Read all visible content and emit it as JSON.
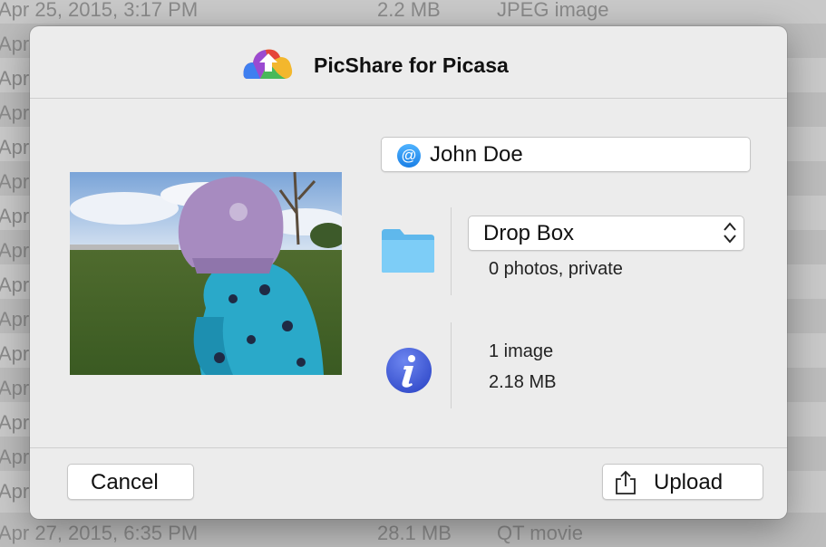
{
  "background_list": {
    "rows": [
      {
        "date": "Apr 25, 2015, 3:17 PM",
        "size": "2.2 MB",
        "kind": "JPEG image"
      },
      {
        "date": "Apr",
        "size": "",
        "kind": ""
      },
      {
        "date": "Apr",
        "size": "",
        "kind": ""
      },
      {
        "date": "Apr",
        "size": "",
        "kind": ""
      },
      {
        "date": "Apr",
        "size": "",
        "kind": ""
      },
      {
        "date": "Apr",
        "size": "",
        "kind": ""
      },
      {
        "date": "Apr",
        "size": "",
        "kind": ""
      },
      {
        "date": "Apr",
        "size": "",
        "kind": ""
      },
      {
        "date": "Apr",
        "size": "",
        "kind": ""
      },
      {
        "date": "Apr",
        "size": "",
        "kind": ""
      },
      {
        "date": "Apr",
        "size": "",
        "kind": ""
      },
      {
        "date": "Apr",
        "size": "",
        "kind": ""
      },
      {
        "date": "Apr",
        "size": "",
        "kind": ""
      },
      {
        "date": "Apr",
        "size": "",
        "kind": ""
      },
      {
        "date": "Apr",
        "size": "",
        "kind": ""
      },
      {
        "date": "Apr 27, 2015, 6:35 PM",
        "size": "28.1 MB",
        "kind": "QT movie"
      }
    ]
  },
  "dialog": {
    "title": "PicShare for Picasa",
    "logo_icon": "picshare-cloud-logo-icon",
    "account": {
      "icon": "at-sign-icon",
      "value": "John Doe"
    },
    "album": {
      "icon": "folder-icon",
      "selected": "Drop Box",
      "info": "0 photos, private"
    },
    "file_info": {
      "icon": "info-icon",
      "count": "1 image",
      "size": "2.18 MB"
    },
    "buttons": {
      "cancel": "Cancel",
      "upload": "Upload",
      "upload_icon": "share-icon"
    }
  },
  "colors": {
    "dialog_bg": "#ececec",
    "folder": "#6cc4f5",
    "info_icon": "#3b55d6",
    "at_icon": "#2a93f0"
  }
}
